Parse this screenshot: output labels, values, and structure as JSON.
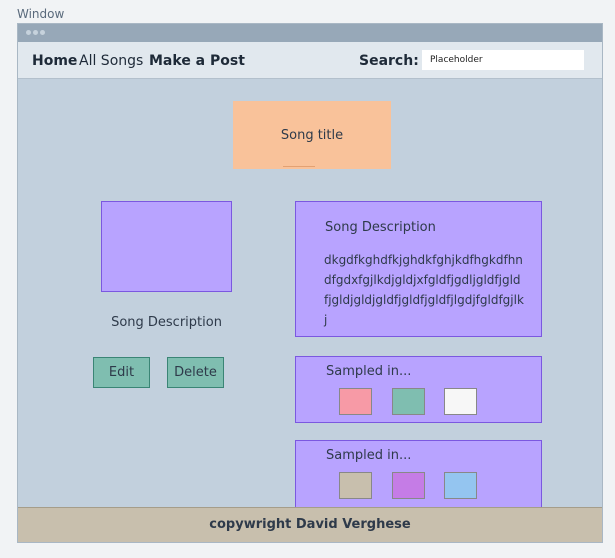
{
  "window_label": "Window",
  "nav": {
    "home": "Home",
    "all_songs": "All Songs",
    "make_post": "Make a Post",
    "search_label": "Search:",
    "search_placeholder": "Placeholder"
  },
  "song": {
    "title": "Song title",
    "left_description": "Song Description",
    "description_heading": "Song Description",
    "description_text": "dkgdfkghdfkjghdkfghjkdfhgkdfhndfgdxfgjlkdjgldjxfgldfjgdljgldfjgldfjgldjgldjgldfjgldfjgldfjlgdjfgldfgjlkj"
  },
  "buttons": {
    "edit": "Edit",
    "delete": "Delete"
  },
  "sampled": [
    {
      "heading": "Sampled in...",
      "swatches": [
        "#f79aa6",
        "#7fbeb0",
        "#f7f7f7"
      ]
    },
    {
      "heading": "Sampled in...",
      "swatches": [
        "#c8bfad",
        "#c57ce6",
        "#94c5f0"
      ]
    }
  ],
  "footer": "copywright David Verghese"
}
